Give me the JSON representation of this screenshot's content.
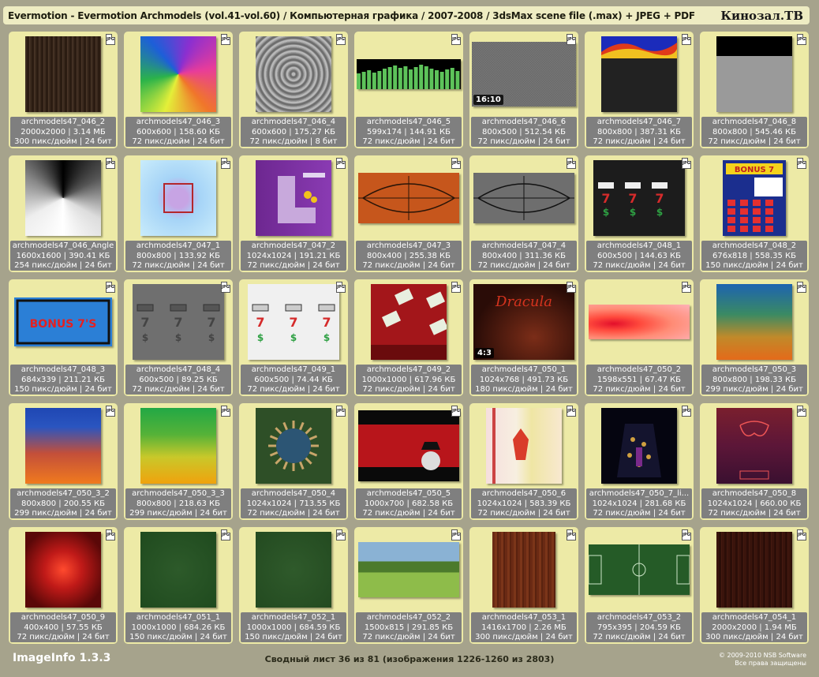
{
  "header": {
    "title": "Evermotion - Evermotion Archmodels (vol.41-vol.60) / Компьютерная графика / 2007-2008 / 3dsMax scene file (.max) + JPEG + PDF",
    "brand": "Кинозал.ТВ"
  },
  "file_type_label": "JPG",
  "thumbnails": [
    {
      "name": "archmodels47_046_2",
      "info": "2000x2000 | 3.14 МБ",
      "meta": "300 пикс/дюйм | 24 бит"
    },
    {
      "name": "archmodels47_046_3",
      "info": "600x600 | 158.60 КБ",
      "meta": "72 пикс/дюйм | 24 бит"
    },
    {
      "name": "archmodels47_046_4",
      "info": "600x600 | 175.27 КБ",
      "meta": "72 пикс/дюйм | 8 бит"
    },
    {
      "name": "archmodels47_046_5",
      "info": "599x174 | 144.91 КБ",
      "meta": "72 пикс/дюйм | 24 бит"
    },
    {
      "name": "archmodels47_046_6",
      "info": "800x500 | 512.54 КБ",
      "meta": "72 пикс/дюйм | 24 бит",
      "ratio": "16:10"
    },
    {
      "name": "archmodels47_046_7",
      "info": "800x800 | 387.31 КБ",
      "meta": "72 пикс/дюйм | 24 бит"
    },
    {
      "name": "archmodels47_046_8",
      "info": "800x800 | 545.46 КБ",
      "meta": "72 пикс/дюйм | 24 бит"
    },
    {
      "name": "archmodels47_046_Angle",
      "info": "1600x1600 | 390.41 КБ",
      "meta": "254 пикс/дюйм | 24 бит"
    },
    {
      "name": "archmodels47_047_1",
      "info": "800x800 | 133.92 КБ",
      "meta": "72 пикс/дюйм | 24 бит"
    },
    {
      "name": "archmodels47_047_2",
      "info": "1024x1024 | 191.21 КБ",
      "meta": "72 пикс/дюйм | 24 бит"
    },
    {
      "name": "archmodels47_047_3",
      "info": "800x400 | 255.38 КБ",
      "meta": "72 пикс/дюйм | 24 бит"
    },
    {
      "name": "archmodels47_047_4",
      "info": "800x400 | 311.36 КБ",
      "meta": "72 пикс/дюйм | 24 бит"
    },
    {
      "name": "archmodels47_048_1",
      "info": "600x500 | 144.63 КБ",
      "meta": "72 пикс/дюйм | 24 бит"
    },
    {
      "name": "archmodels47_048_2",
      "info": "676x818 | 558.35 КБ",
      "meta": "150 пикс/дюйм | 24 бит"
    },
    {
      "name": "archmodels47_048_3",
      "info": "684x339 | 211.21 КБ",
      "meta": "150 пикс/дюйм | 24 бит"
    },
    {
      "name": "archmodels47_048_4",
      "info": "600x500 | 89.25 КБ",
      "meta": "72 пикс/дюйм | 24 бит"
    },
    {
      "name": "archmodels47_049_1",
      "info": "600x500 | 74.44 КБ",
      "meta": "72 пикс/дюйм | 24 бит"
    },
    {
      "name": "archmodels47_049_2",
      "info": "1000x1000 | 617.96 КБ",
      "meta": "72 пикс/дюйм | 24 бит"
    },
    {
      "name": "archmodels47_050_1",
      "info": "1024x768 | 491.73 КБ",
      "meta": "180 пикс/дюйм | 24 бит",
      "ratio": "4:3"
    },
    {
      "name": "archmodels47_050_2",
      "info": "1598x551 | 67.47 КБ",
      "meta": "72 пикс/дюйм | 24 бит"
    },
    {
      "name": "archmodels47_050_3",
      "info": "800x800 | 198.33 КБ",
      "meta": "299 пикс/дюйм | 24 бит"
    },
    {
      "name": "archmodels47_050_3_2",
      "info": "800x800 | 200.55 КБ",
      "meta": "299 пикс/дюйм | 24 бит"
    },
    {
      "name": "archmodels47_050_3_3",
      "info": "800x800 | 218.63 КБ",
      "meta": "299 пикс/дюйм | 24 бит"
    },
    {
      "name": "archmodels47_050_4",
      "info": "1024x1024 | 713.55 КБ",
      "meta": "72 пикс/дюйм | 24 бит"
    },
    {
      "name": "archmodels47_050_5",
      "info": "1000x700 | 682.58 КБ",
      "meta": "72 пикс/дюйм | 24 бит"
    },
    {
      "name": "archmodels47_050_6",
      "info": "1024x1024 | 583.39 КБ",
      "meta": "72 пикс/дюйм | 24 бит"
    },
    {
      "name": "archmodels47_050_7_li...",
      "info": "1024x1024 | 281.68 КБ",
      "meta": "72 пикс/дюйм | 24 бит"
    },
    {
      "name": "archmodels47_050_8",
      "info": "1024x1024 | 660.00 КБ",
      "meta": "72 пикс/дюйм | 24 бит"
    },
    {
      "name": "archmodels47_050_9",
      "info": "400x400 | 57.55 КБ",
      "meta": "72 пикс/дюйм | 24 бит"
    },
    {
      "name": "archmodels47_051_1",
      "info": "1000x1000 | 684.26 КБ",
      "meta": "150 пикс/дюйм | 24 бит"
    },
    {
      "name": "archmodels47_052_1",
      "info": "1000x1000 | 684.59 КБ",
      "meta": "150 пикс/дюйм | 24 бит"
    },
    {
      "name": "archmodels47_052_2",
      "info": "1500x815 | 291.85 КБ",
      "meta": "72 пикс/дюйм | 24 бит"
    },
    {
      "name": "archmodels47_053_1",
      "info": "1416x1700 | 2.26 МБ",
      "meta": "300 пикс/дюйм | 24 бит"
    },
    {
      "name": "archmodels47_053_2",
      "info": "795x395 | 204.59 КБ",
      "meta": "72 пикс/дюйм | 24 бит"
    },
    {
      "name": "archmodels47_054_1",
      "info": "2000x2000 | 1.94 МБ",
      "meta": "300 пикс/дюйм | 24 бит"
    }
  ],
  "footer": {
    "app_name": "ImageInfo 1.3.3",
    "sheet_info": "Сводный лист 36 из 81 (изображения 1226-1260 из 2803)",
    "copyright": "© 2009-2010 NSB Software",
    "rights": "Все права защищены"
  }
}
